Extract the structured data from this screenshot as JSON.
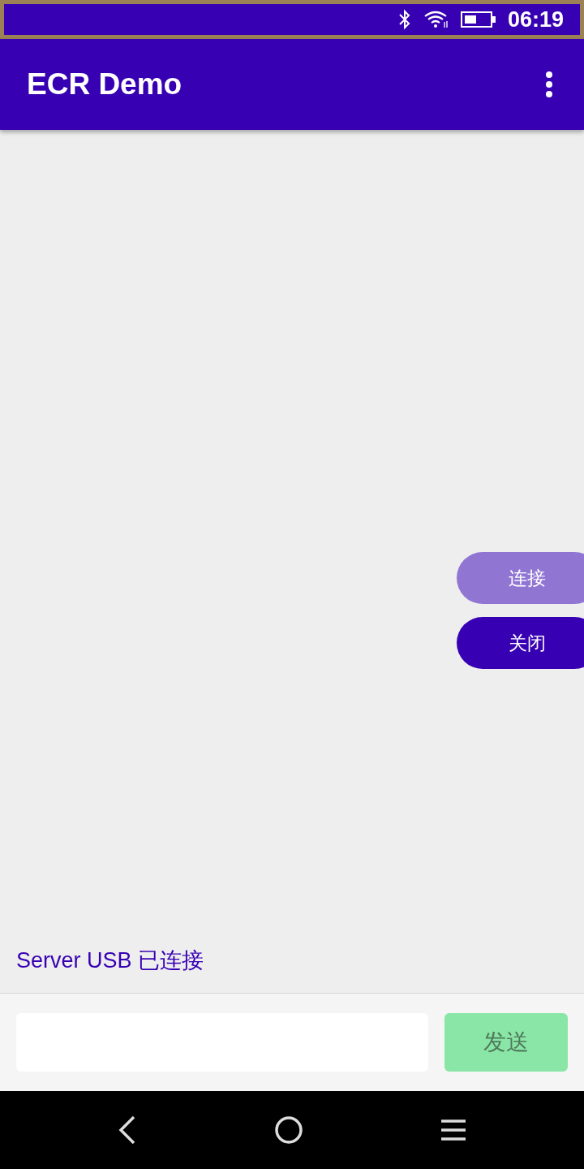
{
  "status_bar": {
    "time": "06:19"
  },
  "app_bar": {
    "title": "ECR Demo"
  },
  "side_buttons": [
    {
      "label": "连接",
      "disabled": true
    },
    {
      "label": "关闭",
      "disabled": false
    }
  ],
  "status_text": "Server USB 已连接",
  "send_button": {
    "label": "发送",
    "disabled": true
  }
}
